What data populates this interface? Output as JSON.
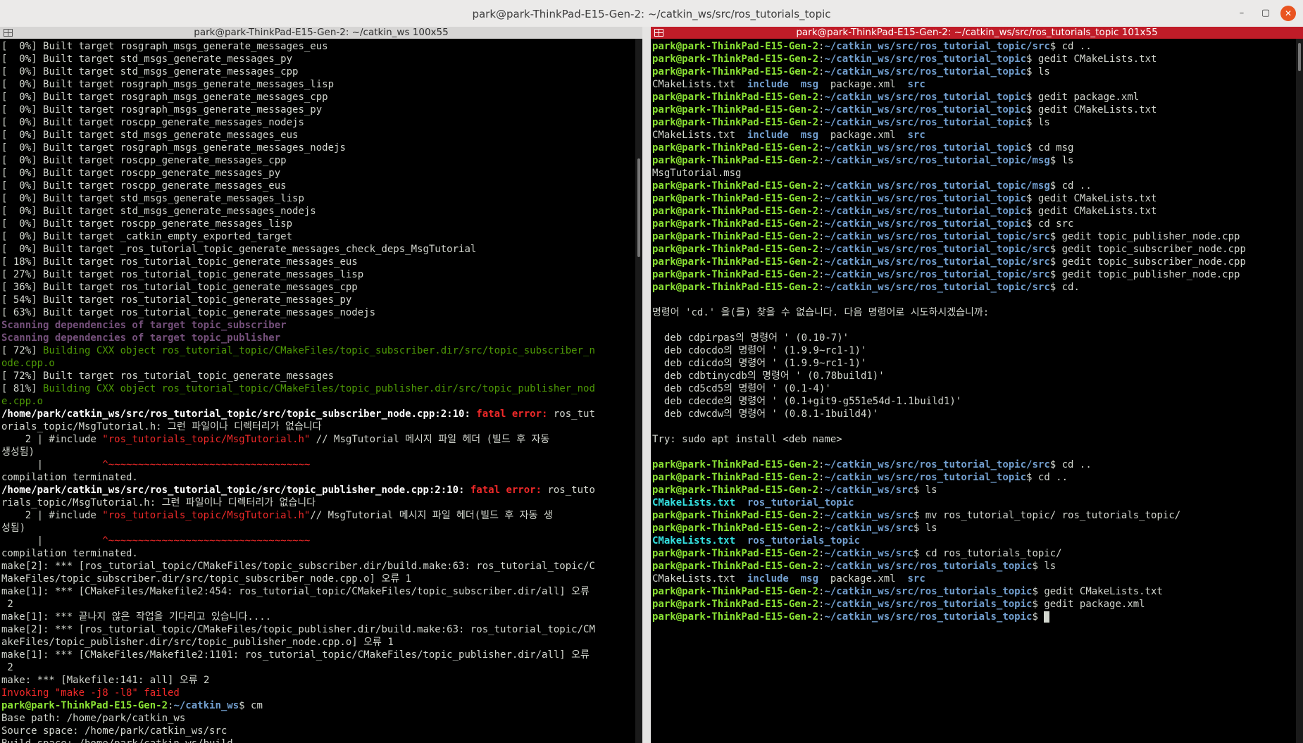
{
  "window": {
    "title": "park@park-ThinkPad-E15-Gen-2: ~/catkin_ws/src/ros_tutorials_topic",
    "minimize": "–",
    "maximize": "▢",
    "close": "✕"
  },
  "colors": {
    "right_title_bg": "#c01c28",
    "prompt_green": "#8ae234",
    "path_blue": "#729fcf",
    "error_red": "#ef2929",
    "scan_magenta": "#75507b"
  },
  "left_pane": {
    "title": "park@park-ThinkPad-E15-Gen-2: ~/catkin_ws 100x55",
    "lines": [
      [
        [
          "[  0%] "
        ],
        [
          "Built target rosgraph_msgs_generate_messages_eus"
        ]
      ],
      [
        [
          "[  0%] "
        ],
        [
          "Built target std_msgs_generate_messages_py"
        ]
      ],
      [
        [
          "[  0%] "
        ],
        [
          "Built target std_msgs_generate_messages_cpp"
        ]
      ],
      [
        [
          "[  0%] "
        ],
        [
          "Built target rosgraph_msgs_generate_messages_lisp"
        ]
      ],
      [
        [
          "[  0%] "
        ],
        [
          "Built target rosgraph_msgs_generate_messages_cpp"
        ]
      ],
      [
        [
          "[  0%] "
        ],
        [
          "Built target rosgraph_msgs_generate_messages_py"
        ]
      ],
      [
        [
          "[  0%] "
        ],
        [
          "Built target roscpp_generate_messages_nodejs"
        ]
      ],
      [
        [
          "[  0%] "
        ],
        [
          "Built target std_msgs_generate_messages_eus"
        ]
      ],
      [
        [
          "[  0%] "
        ],
        [
          "Built target rosgraph_msgs_generate_messages_nodejs"
        ]
      ],
      [
        [
          "[  0%] "
        ],
        [
          "Built target roscpp_generate_messages_cpp"
        ]
      ],
      [
        [
          "[  0%] "
        ],
        [
          "Built target roscpp_generate_messages_py"
        ]
      ],
      [
        [
          "[  0%] "
        ],
        [
          "Built target roscpp_generate_messages_eus"
        ]
      ],
      [
        [
          "[  0%] "
        ],
        [
          "Built target std_msgs_generate_messages_lisp"
        ]
      ],
      [
        [
          "[  0%] "
        ],
        [
          "Built target std_msgs_generate_messages_nodejs"
        ]
      ],
      [
        [
          "[  0%] "
        ],
        [
          "Built target roscpp_generate_messages_lisp"
        ]
      ],
      [
        [
          "[  0%] "
        ],
        [
          "Built target _catkin_empty_exported_target"
        ]
      ],
      [
        [
          "[  0%] "
        ],
        [
          "Built target _ros_tutorial_topic_generate_messages_check_deps_MsgTutorial"
        ]
      ],
      [
        [
          "[ 18%] "
        ],
        [
          "Built target ros_tutorial_topic_generate_messages_eus"
        ]
      ],
      [
        [
          "[ 27%] "
        ],
        [
          "Built target ros_tutorial_topic_generate_messages_lisp"
        ]
      ],
      [
        [
          "[ 36%] "
        ],
        [
          "Built target ros_tutorial_topic_generate_messages_cpp"
        ]
      ],
      [
        [
          "[ 54%] "
        ],
        [
          "Built target ros_tutorial_topic_generate_messages_py"
        ]
      ],
      [
        [
          "[ 63%] "
        ],
        [
          "Built target ros_tutorial_topic_generate_messages_nodejs"
        ]
      ],
      [
        [
          "Scanning dependencies of target topic_subscriber",
          "mg"
        ]
      ],
      [
        [
          "Scanning dependencies of target topic_publisher",
          "mg"
        ]
      ],
      [
        [
          "[ 72%] "
        ],
        [
          "Building CXX object ros_tutorial_topic/CMakeFiles/topic_subscriber.dir/src/topic_subscriber_n",
          "g2"
        ]
      ],
      [
        [
          "ode.cpp.o",
          "g2"
        ]
      ],
      [
        [
          "[ 72%] "
        ],
        [
          "Built target ros_tutorial_topic_generate_messages"
        ]
      ],
      [
        [
          "[ 81%] "
        ],
        [
          "Building CXX object ros_tutorial_topic/CMakeFiles/topic_publisher.dir/src/topic_publisher_nod",
          "g2"
        ]
      ],
      [
        [
          "e.cpp.o",
          "g2"
        ]
      ],
      [
        [
          "/home/park/catkin_ws/src/ros_tutorial_topic/src/topic_subscriber_node.cpp:2:10: ",
          "wb"
        ],
        [
          "fatal error: ",
          "rb"
        ],
        [
          "ros_tut"
        ]
      ],
      [
        [
          "orials_topic/MsgTutorial.h: 그런 파일이나 디렉터리가 없습니다"
        ]
      ],
      [
        [
          "    2 | #include "
        ],
        [
          "\"ros_tutorials_topic/MsgTutorial.h\"",
          "r"
        ],
        [
          " // MsgTutorial 메시지 파일 헤더 (빌드 후 자동"
        ]
      ],
      [
        [
          "생성됨)"
        ]
      ],
      [
        [
          "      |          "
        ],
        [
          "^~~~~~~~~~~~~~~~~~~~~~~~~~~~~~~~~~~",
          "r"
        ]
      ],
      [
        [
          "compilation terminated."
        ]
      ],
      [
        [
          "/home/park/catkin_ws/src/ros_tutorial_topic/src/topic_publisher_node.cpp:2:10: ",
          "wb"
        ],
        [
          "fatal error: ",
          "rb"
        ],
        [
          "ros_tuto"
        ]
      ],
      [
        [
          "rials_topic/MsgTutorial.h: 그런 파일이나 디렉터리가 없습니다"
        ]
      ],
      [
        [
          "    2 | #include "
        ],
        [
          "\"ros_tutorials_topic/MsgTutorial.h\"",
          "r"
        ],
        [
          "// MsgTutorial 메시지 파일 헤더(빌드 후 자동 생"
        ]
      ],
      [
        [
          "성됨)"
        ]
      ],
      [
        [
          "      |          "
        ],
        [
          "^~~~~~~~~~~~~~~~~~~~~~~~~~~~~~~~~~~",
          "r"
        ]
      ],
      [
        [
          "compilation terminated."
        ]
      ],
      [
        [
          "make[2]: *** [ros_tutorial_topic/CMakeFiles/topic_subscriber.dir/build.make:63: ros_tutorial_topic/C"
        ]
      ],
      [
        [
          "MakeFiles/topic_subscriber.dir/src/topic_subscriber_node.cpp.o] 오류 1"
        ]
      ],
      [
        [
          "make[1]: *** [CMakeFiles/Makefile2:454: ros_tutorial_topic/CMakeFiles/topic_subscriber.dir/all] 오류"
        ]
      ],
      [
        [
          " 2"
        ]
      ],
      [
        [
          "make[1]: *** 끝나지 않은 작업을 기다리고 있습니다...."
        ]
      ],
      [
        [
          "make[2]: *** [ros_tutorial_topic/CMakeFiles/topic_publisher.dir/build.make:63: ros_tutorial_topic/CM"
        ]
      ],
      [
        [
          "akeFiles/topic_publisher.dir/src/topic_publisher_node.cpp.o] 오류 1"
        ]
      ],
      [
        [
          "make[1]: *** [CMakeFiles/Makefile2:1101: ros_tutorial_topic/CMakeFiles/topic_publisher.dir/all] 오류"
        ]
      ],
      [
        [
          " 2"
        ]
      ],
      [
        [
          "make: *** [Makefile:141: all] 오류 2"
        ]
      ],
      [
        [
          "Invoking \"make -j8 -l8\" failed",
          "r"
        ]
      ],
      [
        [
          "park@park-ThinkPad-E15-Gen-2",
          "g"
        ],
        [
          ":"
        ],
        [
          "~/catkin_ws",
          "b"
        ],
        [
          "$ cm"
        ]
      ],
      [
        [
          "Base path: /home/park/catkin_ws"
        ]
      ],
      [
        [
          "Source space: /home/park/catkin_ws/src"
        ]
      ],
      [
        [
          "Build space: /home/park/catkin_ws/build"
        ]
      ]
    ]
  },
  "right_pane": {
    "title": "park@park-ThinkPad-E15-Gen-2: ~/catkin_ws/src/ros_tutorials_topic 101x55",
    "lines": [
      [
        [
          "park@park-ThinkPad-E15-Gen-2",
          "g"
        ],
        [
          ":"
        ],
        [
          "~/catkin_ws/src/ros_tutorial_topic/src",
          "b"
        ],
        [
          "$ cd .."
        ]
      ],
      [
        [
          "park@park-ThinkPad-E15-Gen-2",
          "g"
        ],
        [
          ":"
        ],
        [
          "~/catkin_ws/src/ros_tutorial_topic",
          "b"
        ],
        [
          "$ gedit CMakeLists.txt"
        ]
      ],
      [
        [
          "park@park-ThinkPad-E15-Gen-2",
          "g"
        ],
        [
          ":"
        ],
        [
          "~/catkin_ws/src/ros_tutorial_topic",
          "b"
        ],
        [
          "$ ls"
        ]
      ],
      [
        [
          "CMakeLists.txt  "
        ],
        [
          "include",
          "b"
        ],
        [
          "  "
        ],
        [
          "msg",
          "b"
        ],
        [
          "  package.xml  "
        ],
        [
          "src",
          "b"
        ]
      ],
      [
        [
          "park@park-ThinkPad-E15-Gen-2",
          "g"
        ],
        [
          ":"
        ],
        [
          "~/catkin_ws/src/ros_tutorial_topic",
          "b"
        ],
        [
          "$ gedit package.xml"
        ]
      ],
      [
        [
          "park@park-ThinkPad-E15-Gen-2",
          "g"
        ],
        [
          ":"
        ],
        [
          "~/catkin_ws/src/ros_tutorial_topic",
          "b"
        ],
        [
          "$ gedit CMakeLists.txt"
        ]
      ],
      [
        [
          "park@park-ThinkPad-E15-Gen-2",
          "g"
        ],
        [
          ":"
        ],
        [
          "~/catkin_ws/src/ros_tutorial_topic",
          "b"
        ],
        [
          "$ ls"
        ]
      ],
      [
        [
          "CMakeLists.txt  "
        ],
        [
          "include",
          "b"
        ],
        [
          "  "
        ],
        [
          "msg",
          "b"
        ],
        [
          "  package.xml  "
        ],
        [
          "src",
          "b"
        ]
      ],
      [
        [
          "park@park-ThinkPad-E15-Gen-2",
          "g"
        ],
        [
          ":"
        ],
        [
          "~/catkin_ws/src/ros_tutorial_topic",
          "b"
        ],
        [
          "$ cd msg"
        ]
      ],
      [
        [
          "park@park-ThinkPad-E15-Gen-2",
          "g"
        ],
        [
          ":"
        ],
        [
          "~/catkin_ws/src/ros_tutorial_topic/msg",
          "b"
        ],
        [
          "$ ls"
        ]
      ],
      [
        [
          "MsgTutorial.msg"
        ]
      ],
      [
        [
          "park@park-ThinkPad-E15-Gen-2",
          "g"
        ],
        [
          ":"
        ],
        [
          "~/catkin_ws/src/ros_tutorial_topic/msg",
          "b"
        ],
        [
          "$ cd .."
        ]
      ],
      [
        [
          "park@park-ThinkPad-E15-Gen-2",
          "g"
        ],
        [
          ":"
        ],
        [
          "~/catkin_ws/src/ros_tutorial_topic",
          "b"
        ],
        [
          "$ gedit CMakeLists.txt"
        ]
      ],
      [
        [
          "park@park-ThinkPad-E15-Gen-2",
          "g"
        ],
        [
          ":"
        ],
        [
          "~/catkin_ws/src/ros_tutorial_topic",
          "b"
        ],
        [
          "$ gedit CMakeLists.txt"
        ]
      ],
      [
        [
          "park@park-ThinkPad-E15-Gen-2",
          "g"
        ],
        [
          ":"
        ],
        [
          "~/catkin_ws/src/ros_tutorial_topic",
          "b"
        ],
        [
          "$ cd src"
        ]
      ],
      [
        [
          "park@park-ThinkPad-E15-Gen-2",
          "g"
        ],
        [
          ":"
        ],
        [
          "~/catkin_ws/src/ros_tutorial_topic/src",
          "b"
        ],
        [
          "$ gedit topic_publisher_node.cpp"
        ]
      ],
      [
        [
          "park@park-ThinkPad-E15-Gen-2",
          "g"
        ],
        [
          ":"
        ],
        [
          "~/catkin_ws/src/ros_tutorial_topic/src",
          "b"
        ],
        [
          "$ gedit topic_subscriber_node.cpp"
        ]
      ],
      [
        [
          "park@park-ThinkPad-E15-Gen-2",
          "g"
        ],
        [
          ":"
        ],
        [
          "~/catkin_ws/src/ros_tutorial_topic/src",
          "b"
        ],
        [
          "$ gedit topic_subscriber_node.cpp"
        ]
      ],
      [
        [
          "park@park-ThinkPad-E15-Gen-2",
          "g"
        ],
        [
          ":"
        ],
        [
          "~/catkin_ws/src/ros_tutorial_topic/src",
          "b"
        ],
        [
          "$ gedit topic_publisher_node.cpp"
        ]
      ],
      [
        [
          "park@park-ThinkPad-E15-Gen-2",
          "g"
        ],
        [
          ":"
        ],
        [
          "~/catkin_ws/src/ros_tutorial_topic/src",
          "b"
        ],
        [
          "$ cd."
        ]
      ],
      [
        [
          ""
        ]
      ],
      [
        [
          "명령어 'cd.' 을(를) 찾을 수 없습니다. 다음 명령어로 시도하시겠습니까:"
        ]
      ],
      [
        [
          ""
        ]
      ],
      [
        [
          "  deb cdpirpas의 명령어 ' (0.10-7)'"
        ]
      ],
      [
        [
          "  deb cdocdo의 명령어 ' (1.9.9~rc1-1)'"
        ]
      ],
      [
        [
          "  deb cdicdo의 명령어 ' (1.9.9~rc1-1)'"
        ]
      ],
      [
        [
          "  deb cdbtinycdb의 명령어 ' (0.78build1)'"
        ]
      ],
      [
        [
          "  deb cd5cd5의 명령어 ' (0.1-4)'"
        ]
      ],
      [
        [
          "  deb cdecde의 명령어 ' (0.1+git9-g551e54d-1.1build1)'"
        ]
      ],
      [
        [
          "  deb cdwcdw의 명령어 ' (0.8.1-1build4)'"
        ]
      ],
      [
        [
          ""
        ]
      ],
      [
        [
          "Try: sudo apt install <deb name>"
        ]
      ],
      [
        [
          ""
        ]
      ],
      [
        [
          "park@park-ThinkPad-E15-Gen-2",
          "g"
        ],
        [
          ":"
        ],
        [
          "~/catkin_ws/src/ros_tutorial_topic/src",
          "b"
        ],
        [
          "$ cd .."
        ]
      ],
      [
        [
          "park@park-ThinkPad-E15-Gen-2",
          "g"
        ],
        [
          ":"
        ],
        [
          "~/catkin_ws/src/ros_tutorial_topic",
          "b"
        ],
        [
          "$ cd .."
        ]
      ],
      [
        [
          "park@park-ThinkPad-E15-Gen-2",
          "g"
        ],
        [
          ":"
        ],
        [
          "~/catkin_ws/src",
          "b"
        ],
        [
          "$ ls"
        ]
      ],
      [
        [
          "CMakeLists.txt",
          "cy"
        ],
        [
          "  "
        ],
        [
          "ros_tutorial_topic",
          "b"
        ]
      ],
      [
        [
          "park@park-ThinkPad-E15-Gen-2",
          "g"
        ],
        [
          ":"
        ],
        [
          "~/catkin_ws/src",
          "b"
        ],
        [
          "$ mv ros_tutorial_topic/ ros_tutorials_topic/"
        ]
      ],
      [
        [
          "park@park-ThinkPad-E15-Gen-2",
          "g"
        ],
        [
          ":"
        ],
        [
          "~/catkin_ws/src",
          "b"
        ],
        [
          "$ ls"
        ]
      ],
      [
        [
          "CMakeLists.txt",
          "cy"
        ],
        [
          "  "
        ],
        [
          "ros_tutorials_topic",
          "b"
        ]
      ],
      [
        [
          "park@park-ThinkPad-E15-Gen-2",
          "g"
        ],
        [
          ":"
        ],
        [
          "~/catkin_ws/src",
          "b"
        ],
        [
          "$ cd ros_tutorials_topic/"
        ]
      ],
      [
        [
          "park@park-ThinkPad-E15-Gen-2",
          "g"
        ],
        [
          ":"
        ],
        [
          "~/catkin_ws/src/ros_tutorials_topic",
          "b"
        ],
        [
          "$ ls"
        ]
      ],
      [
        [
          "CMakeLists.txt  "
        ],
        [
          "include",
          "b"
        ],
        [
          "  "
        ],
        [
          "msg",
          "b"
        ],
        [
          "  package.xml  "
        ],
        [
          "src",
          "b"
        ]
      ],
      [
        [
          "park@park-ThinkPad-E15-Gen-2",
          "g"
        ],
        [
          ":"
        ],
        [
          "~/catkin_ws/src/ros_tutorials_topic",
          "b"
        ],
        [
          "$ gedit CMakeLists.txt"
        ]
      ],
      [
        [
          "park@park-ThinkPad-E15-Gen-2",
          "g"
        ],
        [
          ":"
        ],
        [
          "~/catkin_ws/src/ros_tutorials_topic",
          "b"
        ],
        [
          "$ gedit package.xml"
        ]
      ],
      [
        [
          "park@park-ThinkPad-E15-Gen-2",
          "g"
        ],
        [
          ":"
        ],
        [
          "~/catkin_ws/src/ros_tutorials_topic",
          "b"
        ],
        [
          "$ "
        ],
        [
          "CURSOR",
          "cur"
        ]
      ]
    ]
  }
}
